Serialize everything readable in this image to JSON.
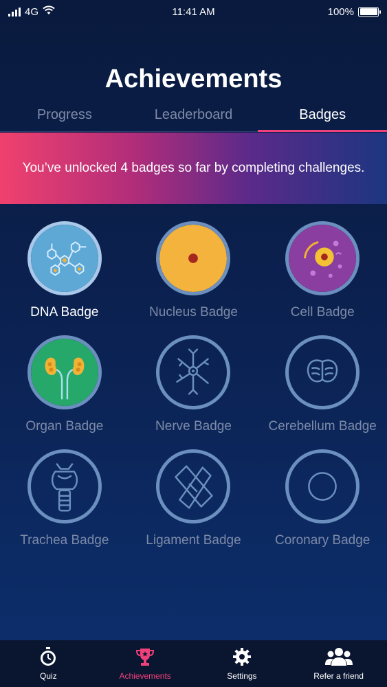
{
  "status_bar": {
    "carrier": "4G",
    "time": "11:41 AM",
    "battery": "100%"
  },
  "page": {
    "title": "Achievements"
  },
  "tabs": [
    {
      "label": "Progress",
      "active": false
    },
    {
      "label": "Leaderboard",
      "active": false
    },
    {
      "label": "Badges",
      "active": true
    }
  ],
  "banner": {
    "text": "You’ve unlocked 4 badges so far by completing challenges."
  },
  "badges": [
    {
      "label": "DNA Badge",
      "icon": "dna-icon",
      "unlocked": true
    },
    {
      "label": "Nucleus Badge",
      "icon": "nucleus-icon",
      "unlocked": true
    },
    {
      "label": "Cell Badge",
      "icon": "cell-icon",
      "unlocked": true
    },
    {
      "label": "Organ Badge",
      "icon": "kidney-icon",
      "unlocked": true
    },
    {
      "label": "Nerve Badge",
      "icon": "neuron-icon",
      "unlocked": false
    },
    {
      "label": "Cerebellum Badge",
      "icon": "cerebellum-icon",
      "unlocked": false
    },
    {
      "label": "Trachea Badge",
      "icon": "trachea-icon",
      "unlocked": false
    },
    {
      "label": "Ligament Badge",
      "icon": "ligament-icon",
      "unlocked": false
    },
    {
      "label": "Coronary Badge",
      "icon": "coronary-icon",
      "unlocked": false
    }
  ],
  "bottom_nav": [
    {
      "label": "Quiz",
      "icon": "stopwatch-icon",
      "active": false
    },
    {
      "label": "Achievements",
      "icon": "trophy-icon",
      "active": true
    },
    {
      "label": "Settings",
      "icon": "gear-icon",
      "active": false
    },
    {
      "label": "Refer a friend",
      "icon": "people-icon",
      "active": false
    }
  ],
  "colors": {
    "accent": "#f0417a",
    "background": "#0b2150",
    "inactive_text": "#7d8aa7",
    "badge_outline": "#6b8fbe"
  }
}
